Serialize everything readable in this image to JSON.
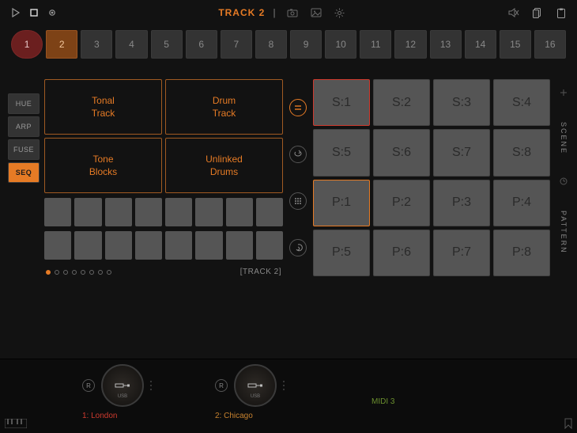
{
  "header": {
    "title": "TRACK 2"
  },
  "steps": [
    "1",
    "2",
    "3",
    "4",
    "5",
    "6",
    "7",
    "8",
    "9",
    "10",
    "11",
    "12",
    "13",
    "14",
    "15",
    "16"
  ],
  "step_active_red_index": 0,
  "step_active_amber_index": 1,
  "left_rail": [
    "HUE",
    "ARP",
    "FUSE",
    "SEQ"
  ],
  "left_rail_active": "SEQ",
  "track_types": [
    {
      "line1": "Tonal",
      "line2": "Track"
    },
    {
      "line1": "Drum",
      "line2": "Track"
    },
    {
      "line1": "Tone",
      "line2": "Blocks"
    },
    {
      "line1": "Unlinked",
      "line2": "Drums"
    }
  ],
  "page_dots": 8,
  "page_dot_active": 0,
  "track_tag": "[TRACK 2]",
  "scene_pads": [
    "S:1",
    "S:2",
    "S:3",
    "S:4",
    "S:5",
    "S:6",
    "S:7",
    "S:8"
  ],
  "pattern_pads": [
    "P:1",
    "P:2",
    "P:3",
    "P:4",
    "P:5",
    "P:6",
    "P:7",
    "P:8"
  ],
  "scene_selected_index": 0,
  "pattern_selected_index": 0,
  "right_rail": {
    "top_label": "SCENE",
    "bottom_label": "PATTERN"
  },
  "nodes": [
    {
      "caption": "1: London",
      "caption_class": "red"
    },
    {
      "caption": "2: Chicago",
      "caption_class": "amber"
    }
  ],
  "midi_label": "MIDI 3"
}
